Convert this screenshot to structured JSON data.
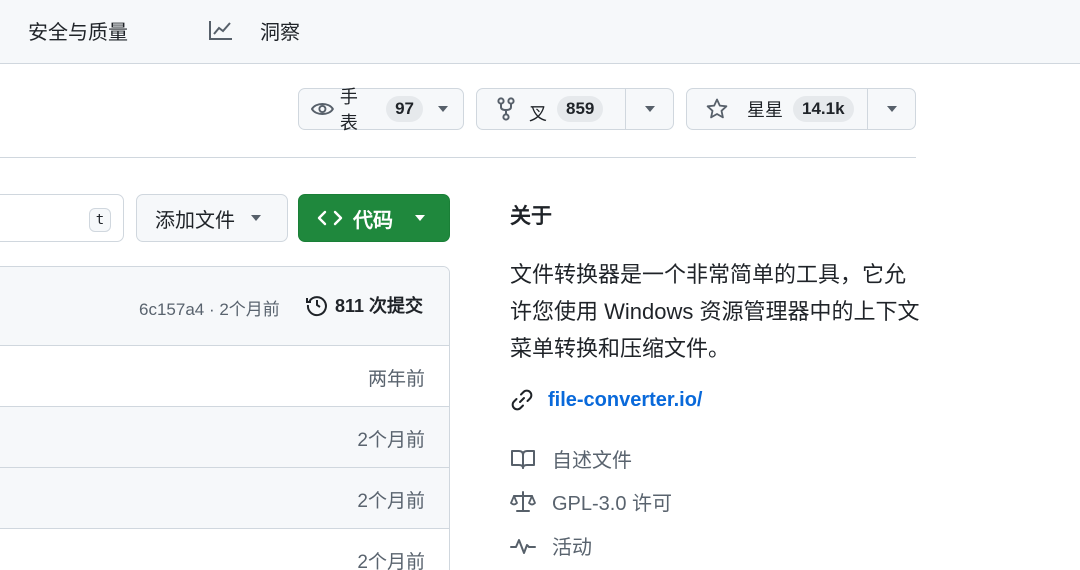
{
  "nav": {
    "security_label": "安全与质量",
    "insights_label": "洞察"
  },
  "actions": {
    "watch_label": "手表",
    "watch_count": "97",
    "fork_label": "叉",
    "fork_count": "859",
    "star_label": "星星",
    "star_count": "14.1k"
  },
  "controls": {
    "goto_shortcut": "t",
    "add_file_label": "添加文件",
    "code_label": "代码"
  },
  "files": {
    "commit_meta": "6c157a4 · 2个月前",
    "commit_count": "811 次提交",
    "rows": [
      {
        "age": "两年前"
      },
      {
        "age": "2个月前"
      },
      {
        "age": "2个月前"
      },
      {
        "age": "2个月前"
      }
    ]
  },
  "about": {
    "title": "关于",
    "description": "文件转换器是一个非常简单的工具，它允许您使用 Windows 资源管理器中的上下文菜单转换和压缩文件。",
    "website": "file-converter.io/",
    "readme_label": "自述文件",
    "license_label": "GPL-3.0 许可",
    "activity_label": "活动"
  },
  "colors": {
    "accent_green": "#1f883d",
    "link_blue": "#0969da",
    "muted_text": "#59636e",
    "border": "#d0d7de"
  }
}
